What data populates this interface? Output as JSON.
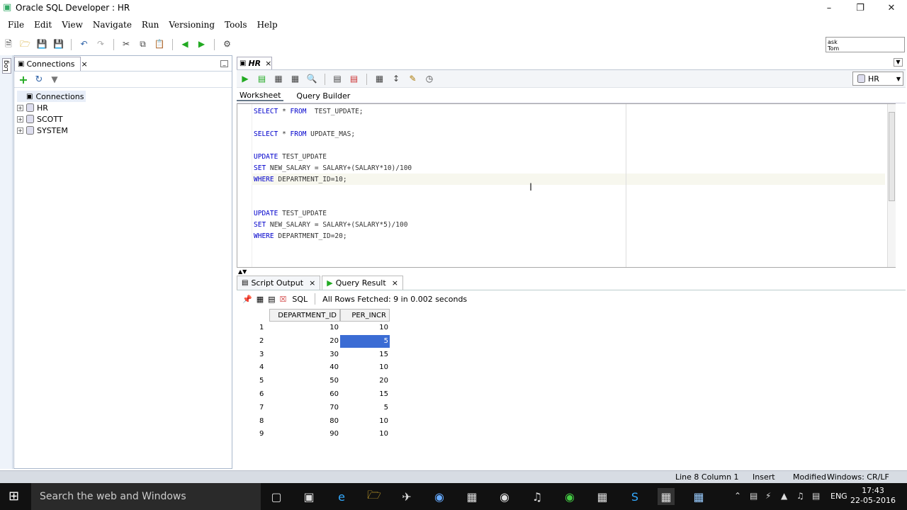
{
  "window": {
    "title": "Oracle SQL Developer : HR",
    "minimize": "–",
    "restore": "❐",
    "close": "✕"
  },
  "menu": [
    "File",
    "Edit",
    "View",
    "Navigate",
    "Run",
    "Versioning",
    "Tools",
    "Help"
  ],
  "ask_box": {
    "line1": "ask",
    "line2": "Tom"
  },
  "log_tab": "Log",
  "connections": {
    "tab_label": "Connections",
    "root": "Connections",
    "items": [
      "HR",
      "SCOTT",
      "SYSTEM"
    ]
  },
  "editor": {
    "doc_tab": "HR",
    "connection_selector": "HR",
    "subtabs": [
      "Worksheet",
      "Query Builder"
    ],
    "lines": [
      "SELECT * FROM  TEST_UPDATE;",
      "",
      "SELECT * FROM UPDATE_MAS;",
      "",
      "UPDATE TEST_UPDATE",
      "SET NEW_SALARY = SALARY+(SALARY*10)/100",
      "WHERE DEPARTMENT_ID=10;",
      "",
      "",
      "UPDATE TEST_UPDATE",
      "SET NEW_SALARY = SALARY+(SALARY*5)/100",
      "WHERE DEPARTMENT_ID=20;"
    ]
  },
  "results": {
    "tabs": [
      "Script Output",
      "Query Result"
    ],
    "sql_label": "SQL",
    "fetch_status": "All Rows Fetched: 9 in 0.002 seconds",
    "columns": [
      "DEPARTMENT_ID",
      "PER_INCR"
    ],
    "rows": [
      [
        "1",
        "10",
        "10"
      ],
      [
        "2",
        "20",
        "5"
      ],
      [
        "3",
        "30",
        "15"
      ],
      [
        "4",
        "40",
        "10"
      ],
      [
        "5",
        "50",
        "20"
      ],
      [
        "6",
        "60",
        "15"
      ],
      [
        "7",
        "70",
        "5"
      ],
      [
        "8",
        "80",
        "10"
      ],
      [
        "9",
        "90",
        "10"
      ]
    ],
    "selected_row": 2,
    "selected_color": "#3b6cd4"
  },
  "status": {
    "position": "Line 8 Column 1",
    "mode": "Insert",
    "modified": "Modified",
    "eol": "Windows: CR/LF Editing"
  },
  "taskbar": {
    "search_placeholder": "Search the web and Windows",
    "lang": "ENG",
    "time": "17:43",
    "date": "22-05-2016"
  }
}
